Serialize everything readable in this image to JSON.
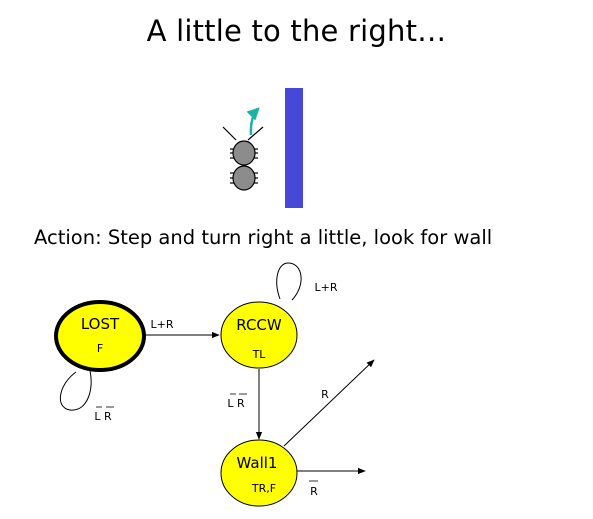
{
  "slide": {
    "title": "A little to the right…",
    "action_text": "Action: Step and turn right a little, look for wall"
  },
  "colors": {
    "state_fill": "#ffff00",
    "wall": "#4848d8",
    "robot_body": "#8c8c8c",
    "turn_arrow": "#19b3a6"
  },
  "states": [
    {
      "id": "lost",
      "name": "LOST",
      "output": "F",
      "initial": true
    },
    {
      "id": "rccw",
      "name": "RCCW",
      "output": "TL",
      "initial": false
    },
    {
      "id": "wall1",
      "name": "Wall1",
      "output": "TR,F",
      "initial": false
    }
  ],
  "transitions": [
    {
      "id": "lost-self",
      "label": "L R",
      "overline": true
    },
    {
      "id": "lost-rccw",
      "label": "L+R",
      "overline": false
    },
    {
      "id": "rccw-self",
      "label": "L+R",
      "overline": false
    },
    {
      "id": "rccw-wall1",
      "label": "L R",
      "overline": true
    },
    {
      "id": "wall1-out-r",
      "label": "R",
      "overline": false
    },
    {
      "id": "wall1-out-notr",
      "label": "R",
      "overline": true
    }
  ],
  "icons": [
    "robot-bug-icon",
    "turn-right-arrow-icon",
    "wall-icon"
  ]
}
